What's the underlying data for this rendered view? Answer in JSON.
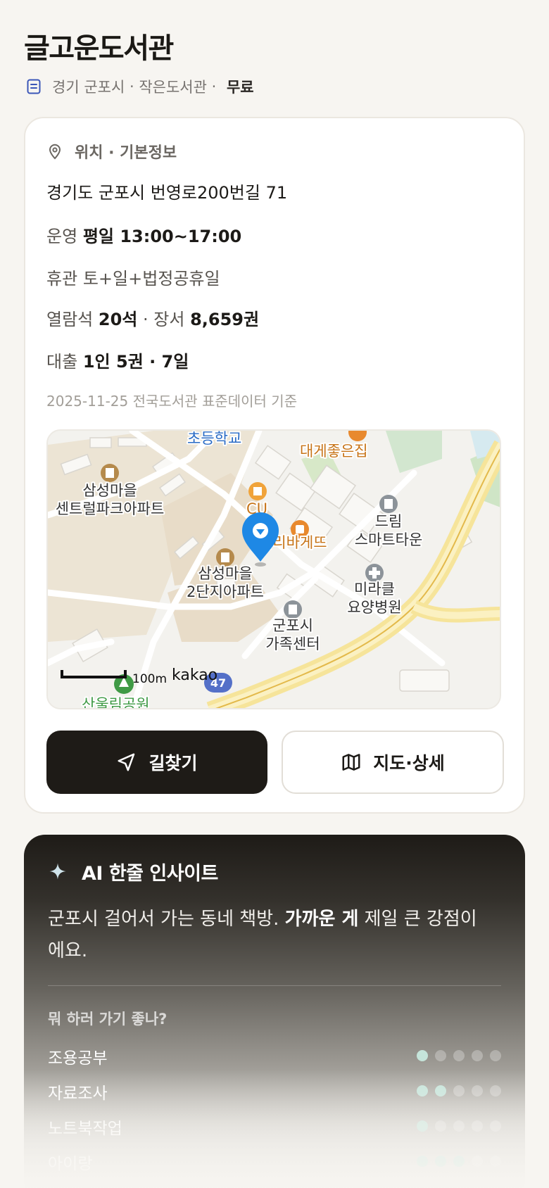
{
  "header": {
    "title": "글고운도서관",
    "region": "경기 군포시",
    "type": "작은도서관",
    "fee": "무료",
    "sep1": " · ",
    "sep2": " · "
  },
  "info": {
    "section_label": "위치 · 기본정보",
    "address": "경기도 군포시 번영로200번길 71",
    "hours_label": "운영",
    "hours_value": "평일 13:00~17:00",
    "closed_label": "휴관",
    "closed_value": "토+일+법정공휴일",
    "seats_label": "열람석",
    "seats_value": "20석",
    "books_sep": " · 장서 ",
    "books_value": "8,659권",
    "loan_label": "대출",
    "loan_value": "1인 5권 · 7일",
    "source": "2025-11-25 전국도서관 표준데이터 기준"
  },
  "map": {
    "labels": {
      "school": "초등학교",
      "restaurant": "대게좋은집",
      "apt1_line1": "삼성마을",
      "apt1_line2": "센트럴파크아파트",
      "cu": "CU",
      "bakery": "파리바게뜨",
      "dream_line1": "드림",
      "dream_line2": "스마트타운",
      "apt2_line1": "삼성마을",
      "apt2_line2": "2단지아파트",
      "hospital_line1": "미라클",
      "hospital_line2": "요양병원",
      "center_line1": "군포시",
      "center_line2": "가족센터",
      "park": "산울림공원",
      "scale": "100m",
      "brand": "kakao",
      "route": "47"
    }
  },
  "buttons": {
    "directions": "길찾기",
    "map_detail": "지도·상세"
  },
  "ai": {
    "title": "AI 한줄 인사이트",
    "text_prefix": "군포시 걸어서 가는 동네 책방. ",
    "text_bold": "가까운 게",
    "text_suffix": " 제일 큰 강점이에요.",
    "question": "뭐 하러 가기 좋나?",
    "activities": [
      {
        "label": "조용공부",
        "score": 1
      },
      {
        "label": "자료조사",
        "score": 2
      },
      {
        "label": "노트북작업",
        "score": 1
      },
      {
        "label": "아이랑",
        "score": 3
      }
    ],
    "max_score": 5
  },
  "colors": {
    "accent_dark": "#1e1b17",
    "map_pin": "#1e88e5",
    "poi_orange": "#d9861c",
    "dot_on": "#c5e4da"
  }
}
